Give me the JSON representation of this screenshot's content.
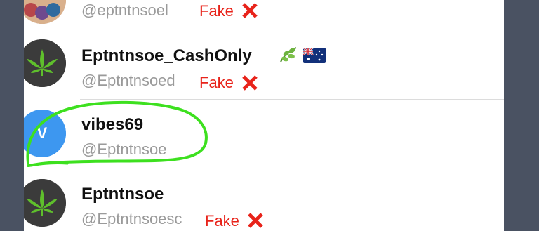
{
  "rows": [
    {
      "name": "",
      "handle": "@eptntnsoel",
      "tag": "Fake"
    },
    {
      "name": "Eptntnsoe_CashOnly",
      "handle": "@Eptntnsoed",
      "tag": "Fake",
      "icons": [
        "leaf-emoji-icon",
        "australia-flag-icon"
      ]
    },
    {
      "name": "vibes69",
      "handle": "@Eptntnsoe",
      "avatar_letter": "V"
    },
    {
      "name": "Eptntnsoe",
      "handle": "@Eptntnsoesc",
      "tag": "Fake"
    }
  ],
  "colors": {
    "fake_red": "#e8231a",
    "annotation_green": "#3de01f",
    "avatar_blue": "#3d97f0",
    "avatar_dark": "#3b3b3b",
    "cannabis_green": "#5fbf2c"
  }
}
